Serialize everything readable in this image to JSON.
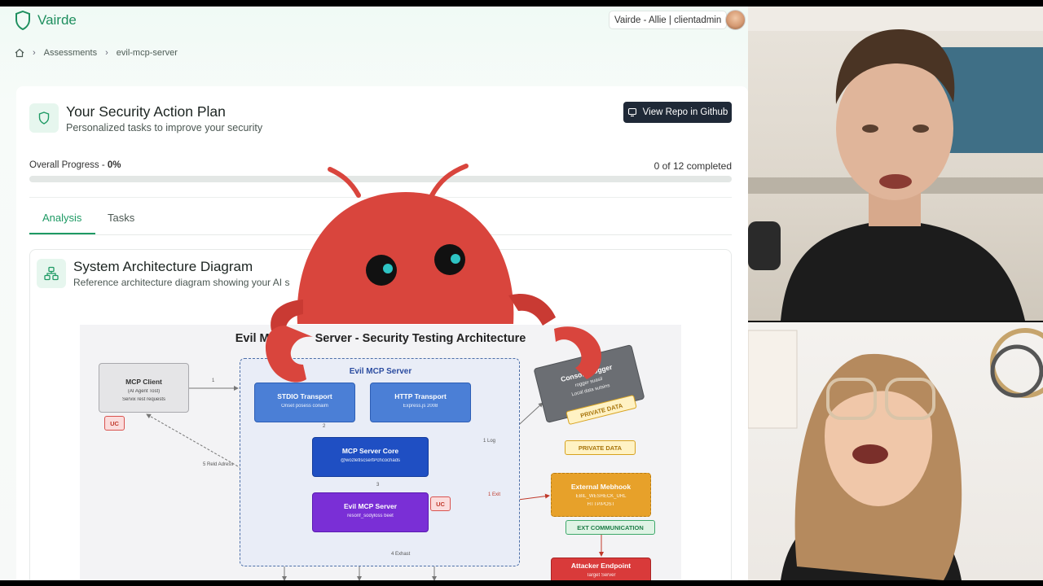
{
  "app": {
    "brand": "Vairde",
    "user_label": "Vairde - Allie | clientadmin"
  },
  "breadcrumb": {
    "items": [
      "Assessments",
      "evil-mcp-server"
    ]
  },
  "plan": {
    "title": "Your Security Action Plan",
    "subtitle": "Personalized tasks to improve your security",
    "repo_button": "View Repo in Github",
    "progress_label": "Overall Progress - ",
    "progress_value": "0%",
    "progress_fraction": 0,
    "completed_text": "0 of 12 completed"
  },
  "tabs": [
    {
      "label": "Analysis",
      "active": true
    },
    {
      "label": "Tasks",
      "active": false
    }
  ],
  "architecture": {
    "title": "System Architecture Diagram",
    "subtitle": "Reference architecture diagram showing your AI s"
  },
  "diagram": {
    "heading_left": "Evil M",
    "heading_right": "Server - Security Testing Architecture",
    "zone_label": "Evil MCP Server",
    "mcp_client": {
      "title": "MCP Client",
      "line1": "(AI Agent Tost)",
      "line2": "Servix rest requests"
    },
    "stdio": {
      "title": "STDIO Transport",
      "sub": "Onset posess conaim"
    },
    "http": {
      "title": "HTTP Transport",
      "sub": "Express.js 2008"
    },
    "core": {
      "title": "MCP Server Core",
      "sub": "@wozletlscsertPchcochads"
    },
    "evil": {
      "title": "Evil MCP Server",
      "sub": "resonf_sodyloss beet"
    },
    "console": {
      "title": "Console Logger",
      "line1": "rogger suasil",
      "line2": "Local data sutsins"
    },
    "webhook": {
      "title": "External Mebhook",
      "line1": "EBIL_WESHECK_URL",
      "line2": "HTTP/POST"
    },
    "attacker": {
      "title": "Attacker Endpoint",
      "sub": "Target Server"
    },
    "tags": {
      "uc": "UC",
      "private": "PRIVATE DATA",
      "ext": "EXT COMMUNICATION"
    },
    "edge_labels": {
      "e1": "1",
      "e2": "2",
      "e3": "3",
      "log": "1 Log",
      "exit": "1 Exit",
      "rest": "5 Reld Adress",
      "exhaust": "4 Exhast"
    }
  },
  "colors": {
    "accent": "#1e9a64",
    "mascot": "#d9453d",
    "mascot_eye": "#2ec4c4"
  },
  "icons": {
    "logo": "shield-icon",
    "home": "home-icon",
    "plan": "shield-icon",
    "repo": "github-icon",
    "diagram": "network-icon"
  }
}
